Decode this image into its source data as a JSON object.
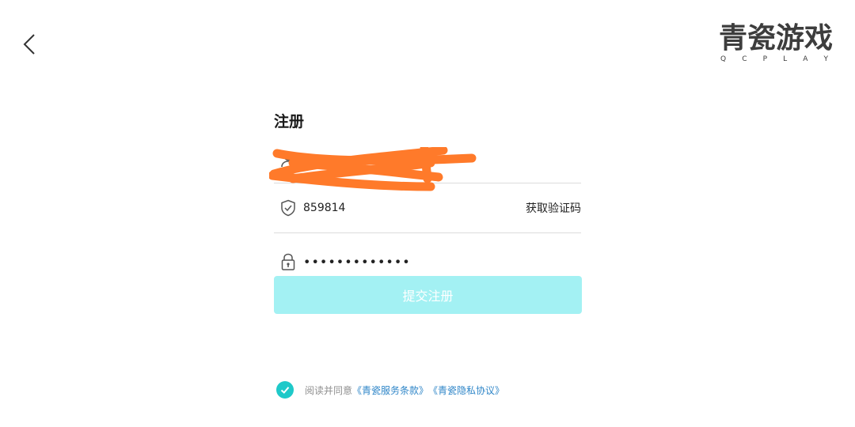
{
  "header": {
    "back_icon": "chevron-left-icon",
    "logo": {
      "text": "青瓷游戏",
      "sub_letters": [
        "Q",
        "C",
        "P",
        "L",
        "A",
        "Y"
      ]
    }
  },
  "form": {
    "title": "注册",
    "username": {
      "icon": "user-icon",
      "value": ""
    },
    "code": {
      "icon": "shield-check-icon",
      "value": "859814",
      "action_label": "获取验证码"
    },
    "password": {
      "icon": "lock-icon",
      "value": "•••••••••••••"
    },
    "submit_label": "提交注册"
  },
  "agreement": {
    "checked": true,
    "prefix": "阅读并同意",
    "terms_link": "《青瓷服务条款》",
    "privacy_link": "《青瓷隐私协议》"
  },
  "colors": {
    "accent": "#1fc9c9",
    "submit_bg": "#a3f1f3",
    "link": "#2f86c8",
    "redaction": "#ff7a2a"
  }
}
